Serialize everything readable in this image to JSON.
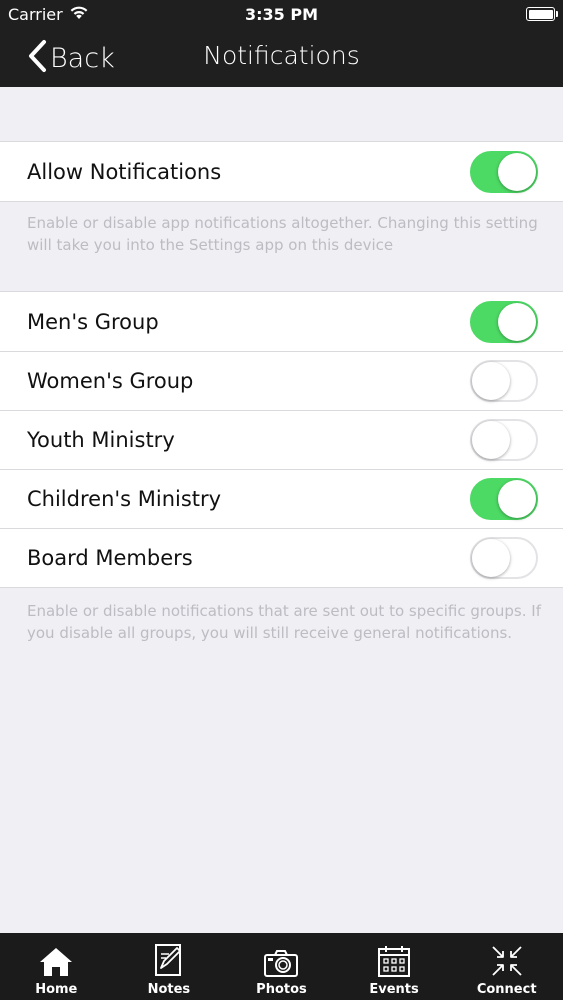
{
  "status_bar": {
    "carrier": "Carrier",
    "time": "3:35 PM"
  },
  "nav": {
    "back_label": "Back",
    "title": "Notifications"
  },
  "allow_section": {
    "row": {
      "label": "Allow Notifications",
      "on": true
    },
    "footer": "Enable or disable app notifications altogether. Changing this setting will take you into the Settings app on this device"
  },
  "groups_section": {
    "rows": [
      {
        "label": "Men's Group",
        "on": true
      },
      {
        "label": "Women's Group",
        "on": false
      },
      {
        "label": "Youth Ministry",
        "on": false
      },
      {
        "label": "Children's Ministry",
        "on": true
      },
      {
        "label": "Board Members",
        "on": false
      }
    ],
    "footer": "Enable or disable notifications that are sent out to specific groups. If you disable all groups, you will still receive general notifications."
  },
  "tabs": [
    {
      "label": "Home",
      "icon": "home-icon"
    },
    {
      "label": "Notes",
      "icon": "notes-icon"
    },
    {
      "label": "Photos",
      "icon": "camera-icon"
    },
    {
      "label": "Events",
      "icon": "calendar-icon"
    },
    {
      "label": "Connect",
      "icon": "connect-icon"
    }
  ],
  "colors": {
    "toggle_on": "#4cd964",
    "bar_background": "#1f1f1f",
    "page_background": "#efeff4"
  }
}
